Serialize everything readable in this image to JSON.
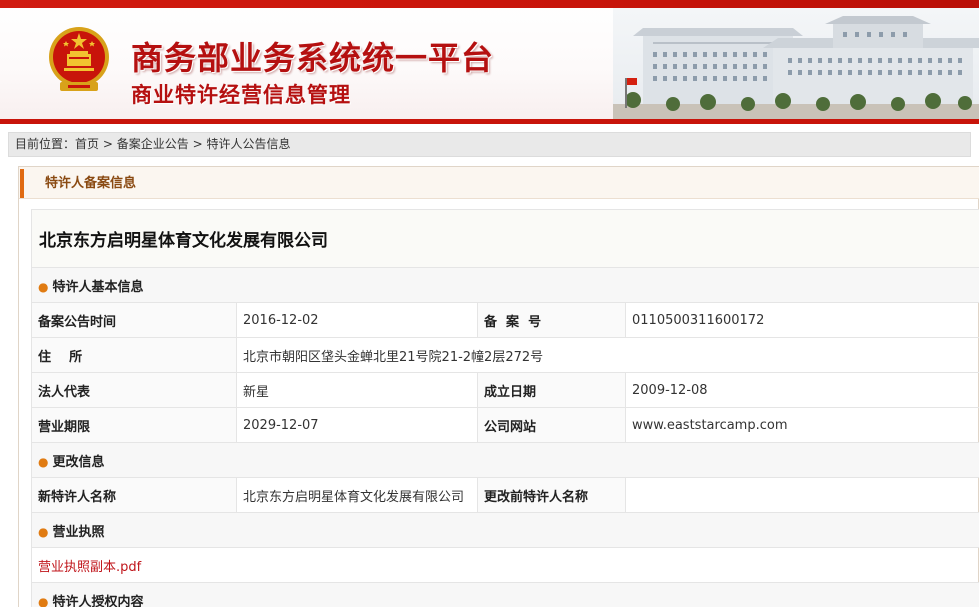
{
  "header": {
    "title_main": "商务部业务系统统一平台",
    "title_sub": "商业特许经营信息管理",
    "accent_color": "#c8140a"
  },
  "breadcrumb": {
    "prefix": "目前位置：",
    "items": [
      "首页",
      "备案企业公告",
      "特许人公告信息"
    ],
    "separator": ">"
  },
  "panel": {
    "title": "特许人备案信息"
  },
  "company": {
    "name": "北京东方启明星体育文化发展有限公司"
  },
  "basic_info": {
    "section_title": "特许人基本信息",
    "announce_time_label": "备案公告时间",
    "announce_time": "2016-12-02",
    "record_no_label": "备  案  号",
    "record_no": "0110500311600172",
    "address_label": "住    所",
    "address": "北京市朝阳区垡头金蝉北里21号院21-2幢2层272号",
    "legal_rep_label": "法人代表",
    "legal_rep": "新星",
    "founded_label": "成立日期",
    "founded": "2009-12-08",
    "term_label": "营业期限",
    "term": "2029-12-07",
    "website_label": "公司网站",
    "website": "www.eaststarcamp.com"
  },
  "change_info": {
    "section_title": "更改信息",
    "new_name_label": "新特许人名称",
    "new_name": "北京东方启明星体育文化发展有限公司",
    "old_name_label": "更改前特许人名称",
    "old_name": ""
  },
  "license": {
    "section_title": "营业执照",
    "file_link": "营业执照副本.pdf"
  },
  "authorization": {
    "section_title": "特许人授权内容"
  }
}
